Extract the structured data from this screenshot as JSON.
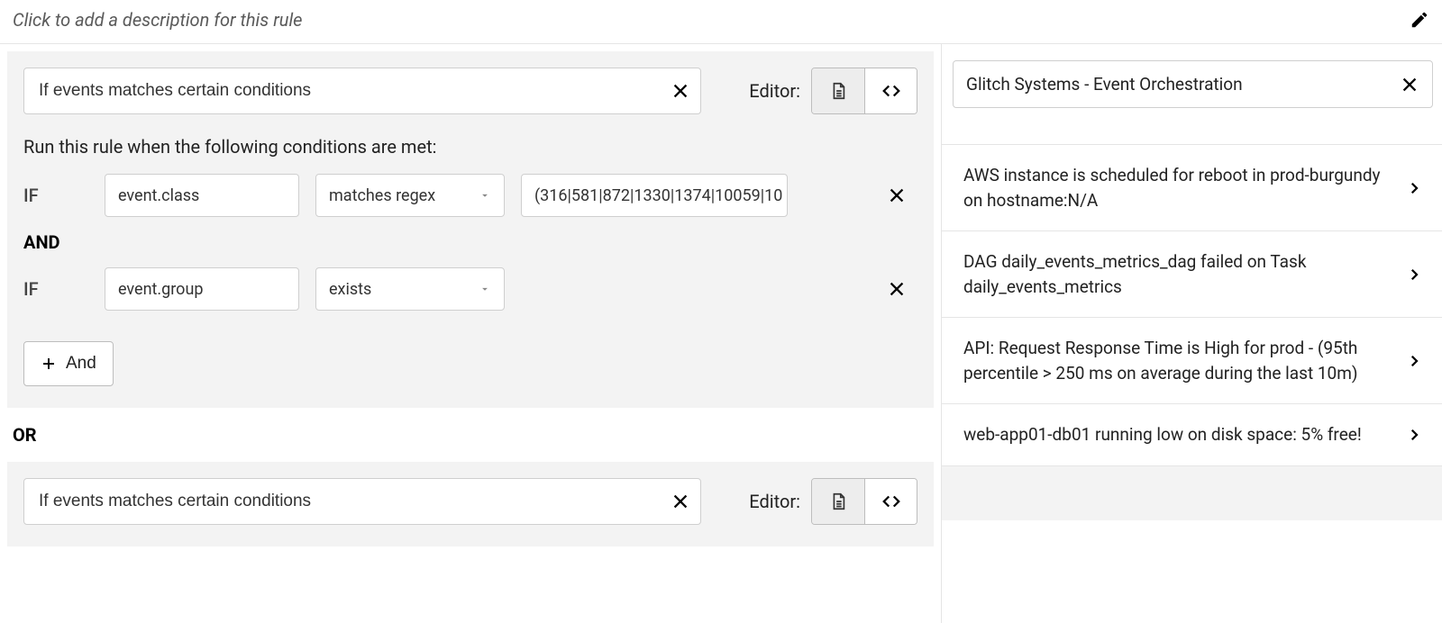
{
  "description_placeholder": "Click to add a description for this rule",
  "blocks": [
    {
      "desc": "If events matches certain conditions",
      "editor_label": "Editor:",
      "run_text": "Run this rule when the following conditions are met:",
      "rows": [
        {
          "prefix": "IF",
          "field": "event.class",
          "operator": "matches regex",
          "value": "(316|581|872|1330|1374|10059|10",
          "has_value": true
        },
        {
          "prefix": "IF",
          "field": "event.group",
          "operator": "exists",
          "value": "",
          "has_value": false
        }
      ],
      "and_label": "AND",
      "add_btn": "And"
    },
    {
      "desc": "If events matches certain conditions",
      "editor_label": "Editor:"
    }
  ],
  "or_label": "OR",
  "right": {
    "source": "Glitch Systems - Event Orchestration",
    "events": [
      "AWS instance is scheduled for reboot in prod-burgundy on hostname:N/A",
      "DAG daily_events_metrics_dag failed on Task daily_events_metrics",
      "API: Request Response Time is High for prod - (95th percentile > 250 ms on average during the last 10m)",
      "web-app01-db01 running low on disk space: 5% free!"
    ]
  }
}
